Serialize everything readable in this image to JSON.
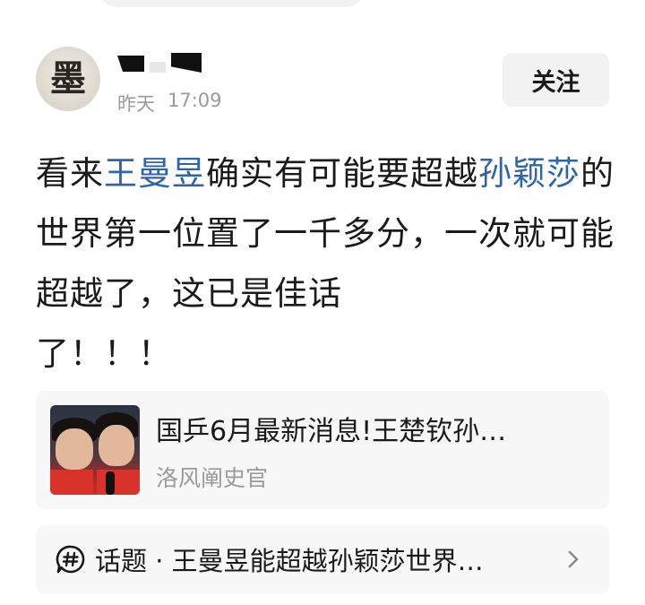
{
  "author": {
    "avatar_char": "墨",
    "date": "昨天",
    "time": "17:09"
  },
  "follow_label": "关注",
  "post": {
    "parts": [
      {
        "text": "看来",
        "tag": false
      },
      {
        "text": "王曼昱",
        "tag": true
      },
      {
        "text": "确实有可能要超越",
        "tag": false
      },
      {
        "text": "孙颖莎",
        "tag": true
      },
      {
        "text": "的世界第一位置了一千多分，一次就可能超越了，这已是佳话\n了！！！",
        "tag": false
      }
    ]
  },
  "link_card": {
    "title": "国乒6月最新消息!王楚钦孙…",
    "source": "洛风阐史官"
  },
  "topic": {
    "label": "话题 · 王曼昱能超越孙颖莎世界…"
  },
  "colors": {
    "tag_blue": "#2f64a8",
    "meta_gray": "#9a9a9a",
    "card_bg": "#f7f7f7"
  },
  "icons": {
    "topic": "hashtag-bubble-icon",
    "topic_arrow": "chevron-right-icon"
  }
}
